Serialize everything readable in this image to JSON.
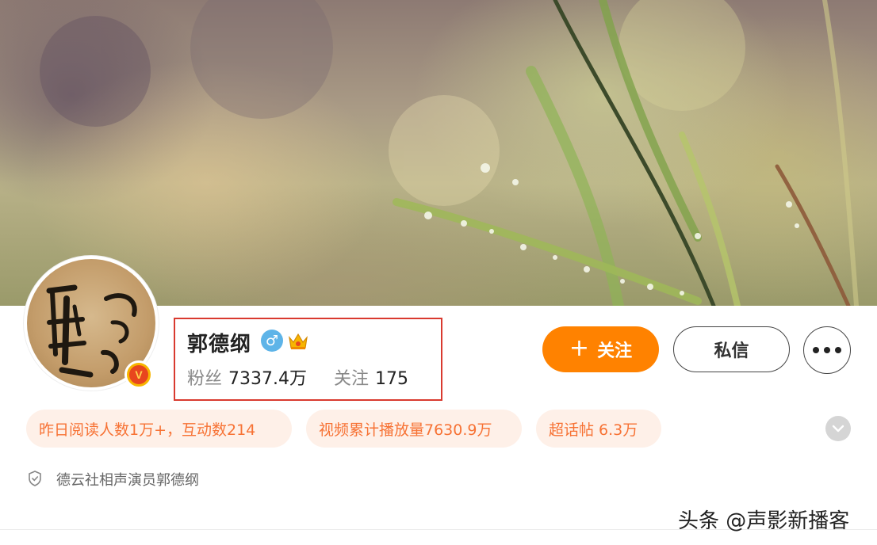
{
  "profile": {
    "name": "郭德纲",
    "gender_symbol": "♂",
    "verified_letter": "V",
    "fans_label": "粉丝",
    "fans_value": "7337.4万",
    "following_label": "关注",
    "following_value": "175"
  },
  "actions": {
    "follow_icon": "+",
    "follow_label": "关注",
    "message_label": "私信"
  },
  "chips": [
    {
      "text": "昨日阅读人数1万+，互动数214"
    },
    {
      "text": "视频累计播放量7630.9万"
    },
    {
      "text": "超话帖 6.3万"
    }
  ],
  "description": "德云社相声演员郭德纲",
  "watermark": "头条 @声影新播客",
  "colors": {
    "accent_orange": "#ff8200",
    "chip_text": "#f77234",
    "chip_bg": "#fef0e8",
    "highlight_red": "#d93a2f",
    "gender_blue": "#5eb4e8"
  },
  "icons": [
    "gender-male-icon",
    "crown-icon",
    "verified-v-icon",
    "more-dots-icon",
    "chevron-down-icon",
    "shield-icon"
  ]
}
